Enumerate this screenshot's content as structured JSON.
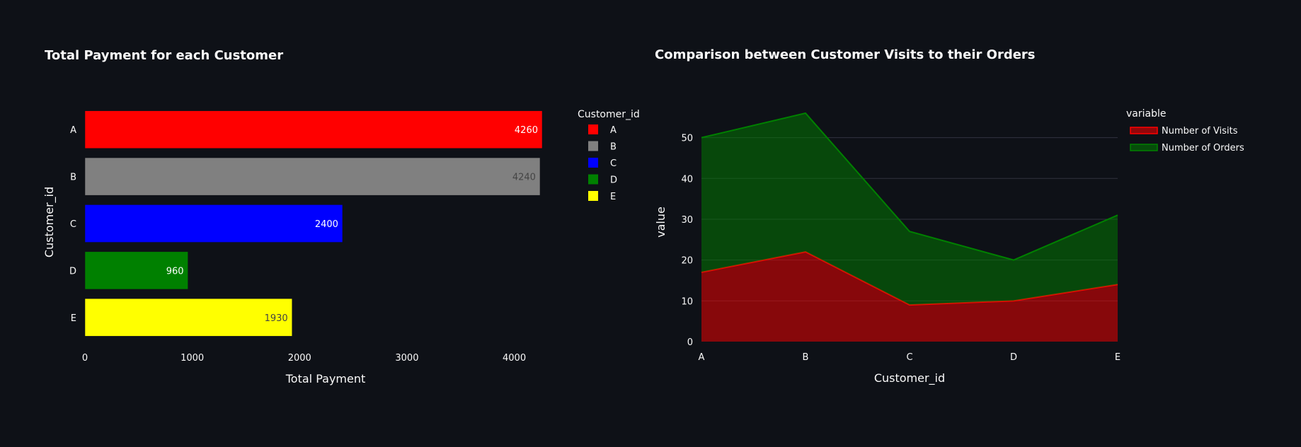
{
  "chart_data": [
    {
      "type": "bar",
      "orientation": "horizontal",
      "title": "Total Payment for each Customer",
      "xlabel": "Total Payment",
      "ylabel": "Customer_id",
      "categories": [
        "A",
        "B",
        "C",
        "D",
        "E"
      ],
      "values": [
        4260,
        4240,
        2400,
        960,
        1930
      ],
      "colors": [
        "#ff0000",
        "#808080",
        "#0000ff",
        "#008000",
        "#ffff00"
      ],
      "data_label_colors": [
        "#ffffff",
        "#444444",
        "#ffffff",
        "#ffffff",
        "#444444"
      ],
      "xlim": [
        0,
        4260
      ],
      "xticks": [
        0,
        1000,
        2000,
        3000,
        4000
      ],
      "grid": false,
      "legend": {
        "title": "Customer_id",
        "placement": "right",
        "items": [
          "A",
          "B",
          "C",
          "D",
          "E"
        ]
      }
    },
    {
      "type": "area",
      "stacked": true,
      "title": "Comparison between Customer Visits to their Orders",
      "xlabel": "Customer_id",
      "ylabel": "value",
      "categories": [
        "A",
        "B",
        "C",
        "D",
        "E"
      ],
      "series": [
        {
          "name": "Number of Visits",
          "values": [
            17,
            22,
            9,
            10,
            14
          ],
          "color": "#ff0000"
        },
        {
          "name": "Number of Orders",
          "values": [
            33,
            34,
            18,
            10,
            17
          ],
          "color": "#008000"
        }
      ],
      "ylim": [
        0,
        56
      ],
      "yticks": [
        0,
        10,
        20,
        30,
        40,
        50
      ],
      "grid": true,
      "legend": {
        "title": "variable",
        "placement": "right",
        "items": [
          "Number of Visits",
          "Number of Orders"
        ]
      }
    }
  ]
}
